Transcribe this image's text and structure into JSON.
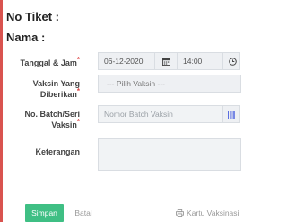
{
  "header": {
    "ticket_label": "No Tiket :",
    "name_label": "Nama :"
  },
  "form": {
    "date_time": {
      "label": "Tanggal & Jam",
      "required_mark": "*",
      "date_value": "06-12-2020",
      "time_value": "14:00"
    },
    "vaccine": {
      "label_line1": "Vaksin Yang",
      "label_line2": "Diberikan",
      "required_mark": "*",
      "selected": "--- Pilih Vaksin ---"
    },
    "batch": {
      "label_line1": "No. Batch/Seri",
      "label_line2": "Vaksin",
      "required_mark": "*",
      "placeholder": "Nomor Batch Vaksin"
    },
    "notes": {
      "label": "Keterangan",
      "value": ""
    }
  },
  "actions": {
    "save_label": "Simpan",
    "cancel_label": "Batal",
    "card_label": "Kartu Vaksinasi"
  },
  "colors": {
    "accent_green": "#3fbf84",
    "required_red": "#e04848",
    "left_bar": "#d9534f"
  },
  "icons": [
    "calendar-icon",
    "clock-icon",
    "barcode-icon",
    "print-icon"
  ]
}
